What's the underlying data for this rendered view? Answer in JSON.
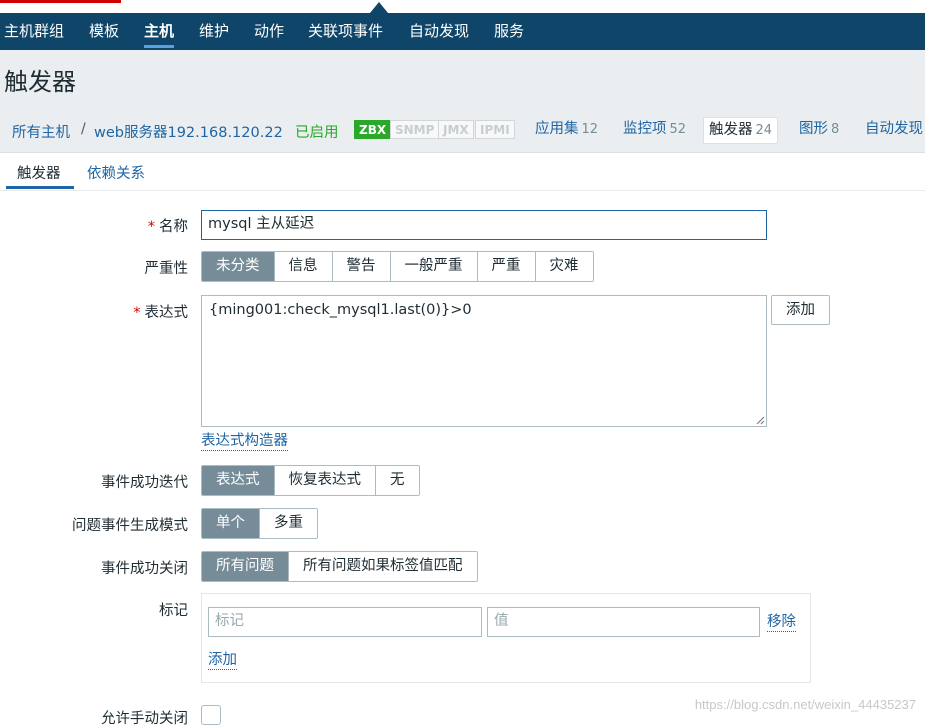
{
  "main_nav": {
    "items": [
      {
        "label": "主机群组",
        "active": false
      },
      {
        "label": "模板",
        "active": false
      },
      {
        "label": "主机",
        "active": true
      },
      {
        "label": "维护",
        "active": false
      },
      {
        "label": "动作",
        "active": false
      },
      {
        "label": "关联项事件",
        "active": false
      },
      {
        "label": "自动发现",
        "active": false
      },
      {
        "label": "服务",
        "active": false
      }
    ]
  },
  "page": {
    "title": "触发器"
  },
  "host_nav": {
    "all_hosts": "所有主机",
    "separator": "/",
    "host_name": "web服务器192.168.120.22",
    "status": "已启用",
    "availability": [
      "ZBX",
      "SNMP",
      "JMX",
      "IPMI"
    ],
    "tabs": [
      {
        "label": "应用集",
        "count": "12"
      },
      {
        "label": "监控项",
        "count": "52"
      },
      {
        "label": "触发器",
        "count": "24"
      },
      {
        "label": "图形",
        "count": "8"
      },
      {
        "label": "自动发现",
        "count": ""
      }
    ]
  },
  "form_tabs": {
    "trigger": "触发器",
    "dependencies": "依赖关系"
  },
  "form": {
    "name": {
      "label": "名称",
      "value": "mysql 主从延迟"
    },
    "severity": {
      "label": "严重性",
      "options": [
        "未分类",
        "信息",
        "警告",
        "一般严重",
        "严重",
        "灾难"
      ],
      "selected": "未分类"
    },
    "expression": {
      "label": "表达式",
      "value": "{ming001:check_mysql1.last(0)}>0",
      "add_button": "添加",
      "constructor_link": "表达式构造器"
    },
    "ok_event_generation": {
      "label": "事件成功迭代",
      "options": [
        "表达式",
        "恢复表达式",
        "无"
      ],
      "selected": "表达式"
    },
    "problem_event_mode": {
      "label": "问题事件生成模式",
      "options": [
        "单个",
        "多重"
      ],
      "selected": "单个"
    },
    "ok_event_closes": {
      "label": "事件成功关闭",
      "options": [
        "所有问题",
        "所有问题如果标签值匹配"
      ],
      "selected": "所有问题"
    },
    "tags": {
      "label": "标记",
      "tag_placeholder": "标记",
      "value_placeholder": "值",
      "remove_link": "移除",
      "add_link": "添加"
    },
    "manual_close": {
      "label": "允许手动关闭",
      "checked": false
    }
  },
  "watermark": "https://blog.csdn.net/weixin_44435237",
  "colors": {
    "nav_bg": "#0e4568",
    "link": "#1f65a3",
    "selected_segment": "#768d99",
    "enabled_green": "#2aa82a",
    "required_red": "#d40000"
  }
}
